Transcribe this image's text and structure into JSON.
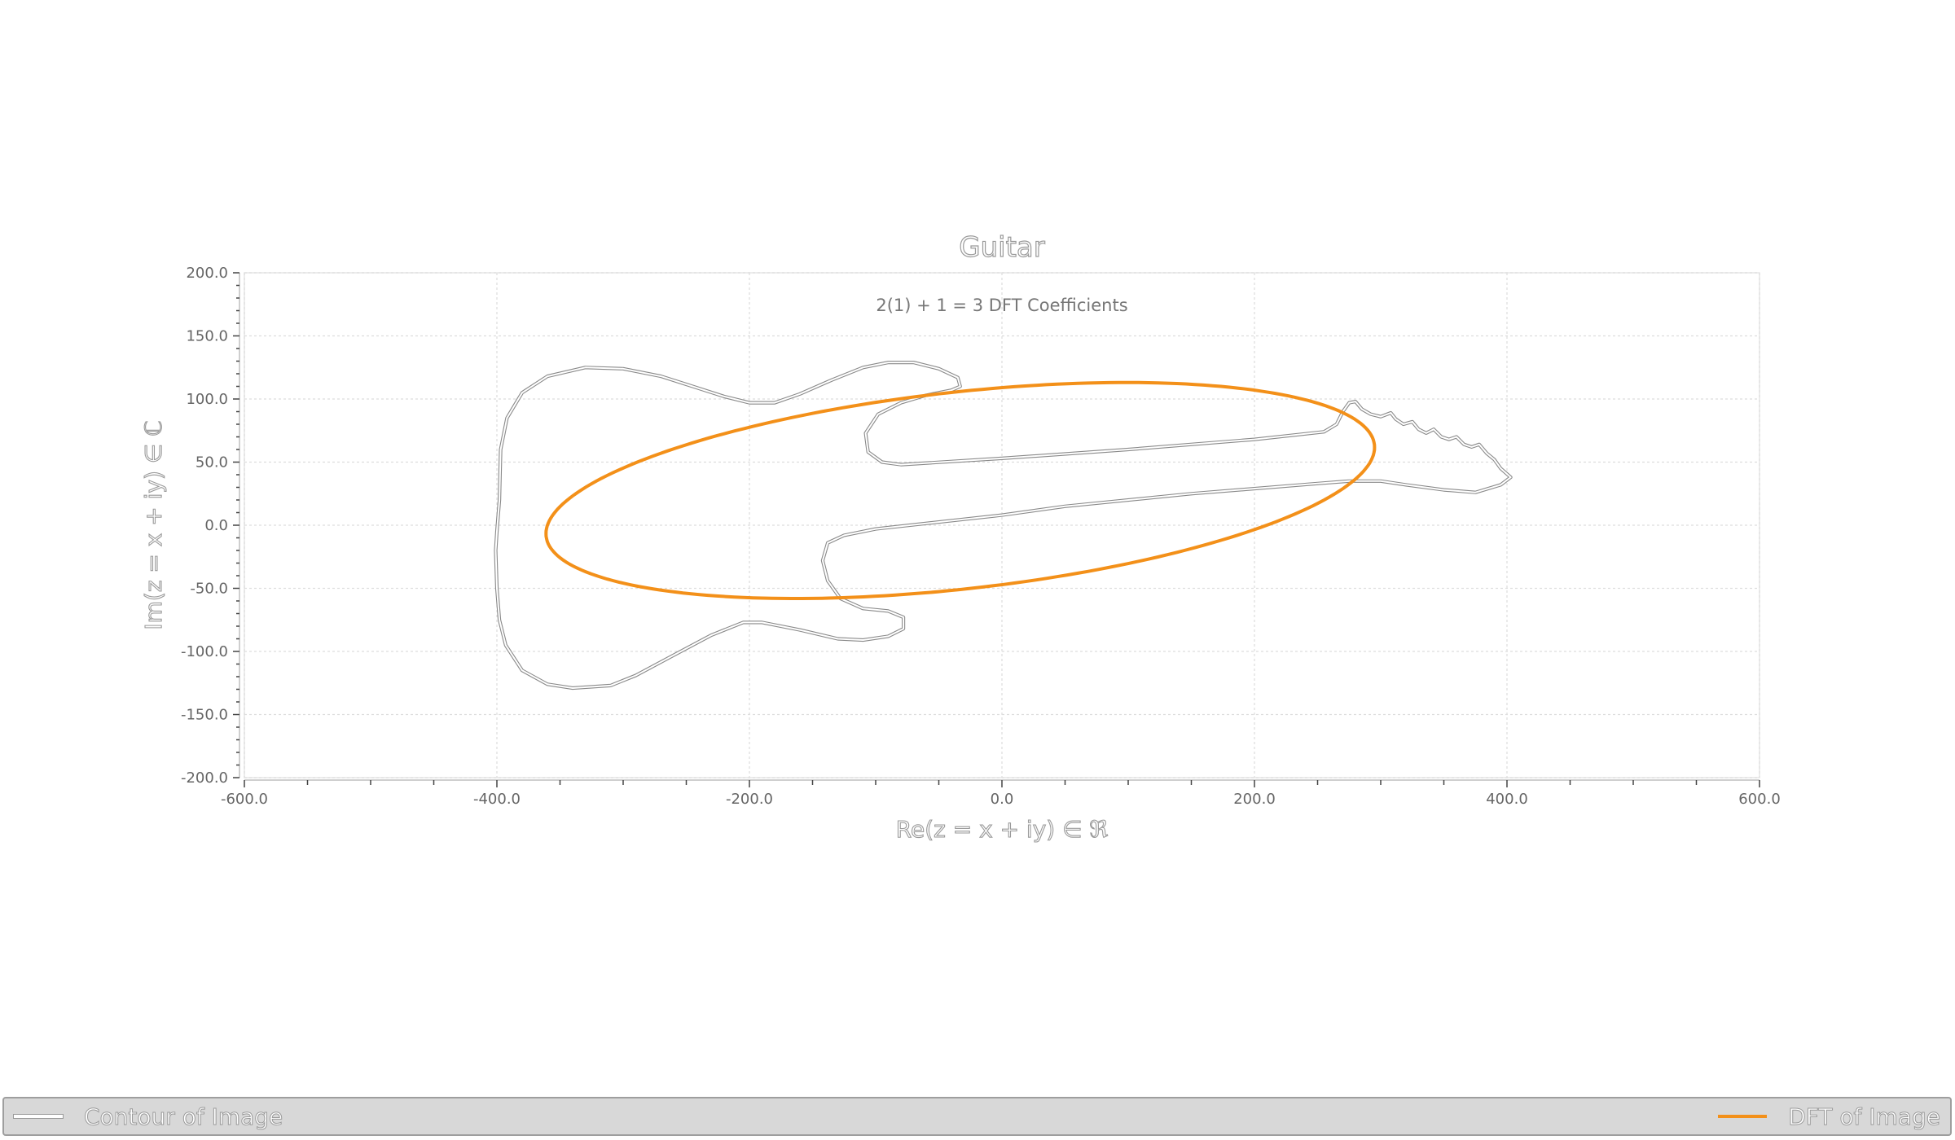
{
  "chart_data": {
    "type": "line",
    "title": "Guitar",
    "subtitle": "2(1) + 1 = 3 DFT Coefficients",
    "xlabel": "Re(z = x + iy)  ∈ ℜ",
    "ylabel": "Im(z = x + iy)  ∈ ℂ",
    "xlim": [
      -600,
      600
    ],
    "ylim": [
      -200,
      200
    ],
    "xticks": [
      "-600.0",
      "-400.0",
      "-200.0",
      "0.0",
      "200.0",
      "400.0",
      "600.0"
    ],
    "yticks": [
      "200.0",
      "150.0",
      "100.0",
      "50.0",
      "0.0",
      "-50.0",
      "-100.0",
      "-150.0",
      "-200.0"
    ],
    "grid": true,
    "legend_position": "bottom",
    "series": [
      {
        "name": "Contour of Image",
        "color": "#ffffff",
        "points": [
          [
            -400,
            -5
          ],
          [
            -398,
            20
          ],
          [
            -397,
            60
          ],
          [
            -392,
            85
          ],
          [
            -380,
            105
          ],
          [
            -360,
            118
          ],
          [
            -330,
            125
          ],
          [
            -300,
            124
          ],
          [
            -270,
            118
          ],
          [
            -245,
            110
          ],
          [
            -220,
            102
          ],
          [
            -200,
            97
          ],
          [
            -180,
            97
          ],
          [
            -160,
            104
          ],
          [
            -135,
            115
          ],
          [
            -110,
            125
          ],
          [
            -90,
            129
          ],
          [
            -70,
            129
          ],
          [
            -50,
            124
          ],
          [
            -35,
            117
          ],
          [
            -33,
            110
          ],
          [
            -40,
            107
          ],
          [
            -60,
            103
          ],
          [
            -80,
            97
          ],
          [
            -98,
            88
          ],
          [
            -108,
            73
          ],
          [
            -106,
            58
          ],
          [
            -95,
            50
          ],
          [
            -80,
            48
          ],
          [
            0,
            53
          ],
          [
            100,
            60
          ],
          [
            200,
            68
          ],
          [
            255,
            74
          ],
          [
            265,
            80
          ],
          [
            270,
            90
          ],
          [
            275,
            97
          ],
          [
            280,
            98
          ],
          [
            285,
            92
          ],
          [
            292,
            88
          ],
          [
            300,
            86
          ],
          [
            308,
            89
          ],
          [
            312,
            84
          ],
          [
            318,
            80
          ],
          [
            325,
            82
          ],
          [
            330,
            76
          ],
          [
            336,
            73
          ],
          [
            342,
            76
          ],
          [
            348,
            70
          ],
          [
            354,
            68
          ],
          [
            360,
            70
          ],
          [
            366,
            64
          ],
          [
            372,
            62
          ],
          [
            378,
            64
          ],
          [
            384,
            57
          ],
          [
            390,
            52
          ],
          [
            395,
            45
          ],
          [
            403,
            38
          ],
          [
            395,
            32
          ],
          [
            375,
            26
          ],
          [
            350,
            28
          ],
          [
            320,
            32
          ],
          [
            300,
            35
          ],
          [
            275,
            35
          ],
          [
            250,
            33
          ],
          [
            150,
            25
          ],
          [
            50,
            15
          ],
          [
            0,
            8
          ],
          [
            -100,
            -3
          ],
          [
            -125,
            -8
          ],
          [
            -138,
            -14
          ],
          [
            -142,
            -28
          ],
          [
            -138,
            -44
          ],
          [
            -128,
            -58
          ],
          [
            -110,
            -66
          ],
          [
            -90,
            -68
          ],
          [
            -78,
            -73
          ],
          [
            -78,
            -82
          ],
          [
            -90,
            -88
          ],
          [
            -110,
            -91
          ],
          [
            -130,
            -90
          ],
          [
            -160,
            -83
          ],
          [
            -190,
            -77
          ],
          [
            -205,
            -77
          ],
          [
            -230,
            -87
          ],
          [
            -260,
            -103
          ],
          [
            -290,
            -119
          ],
          [
            -310,
            -127
          ],
          [
            -340,
            -129
          ],
          [
            -360,
            -126
          ],
          [
            -380,
            -115
          ],
          [
            -393,
            -95
          ],
          [
            -398,
            -75
          ],
          [
            -400,
            -50
          ],
          [
            -401,
            -20
          ],
          [
            -400,
            -5
          ]
        ]
      },
      {
        "name": "DFT of Image",
        "color": "#f39019",
        "shape": "ellipse",
        "center": [
          -33,
          27.5
        ],
        "semi_major": 330,
        "semi_minor": 78,
        "rotation_deg": 6.3
      }
    ]
  },
  "legend": {
    "items": [
      {
        "label": "Contour of Image",
        "color": "#ffffff"
      },
      {
        "label": "DFT of Image",
        "color": "#f39019"
      }
    ]
  }
}
